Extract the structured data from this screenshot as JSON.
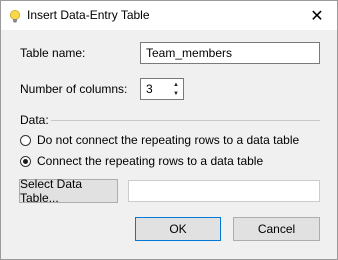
{
  "window": {
    "title": "Insert Data-Entry Table",
    "close_glyph": "✕",
    "icon": "lightbulb-icon",
    "accent_color": "#0078d7"
  },
  "form": {
    "table_name_label": "Table name:",
    "table_name_value": "Team_members",
    "columns_label": "Number of columns:",
    "columns_value": "3",
    "spin_up_glyph": "▲",
    "spin_down_glyph": "▼",
    "data_group_label": "Data:",
    "radio_options": [
      {
        "label": "Do not connect the repeating rows to a data table",
        "checked": false
      },
      {
        "label": "Connect the repeating rows to a data table",
        "checked": true
      }
    ],
    "select_table_button": "Select Data Table...",
    "selected_table_value": ""
  },
  "buttons": {
    "ok": "OK",
    "cancel": "Cancel"
  }
}
